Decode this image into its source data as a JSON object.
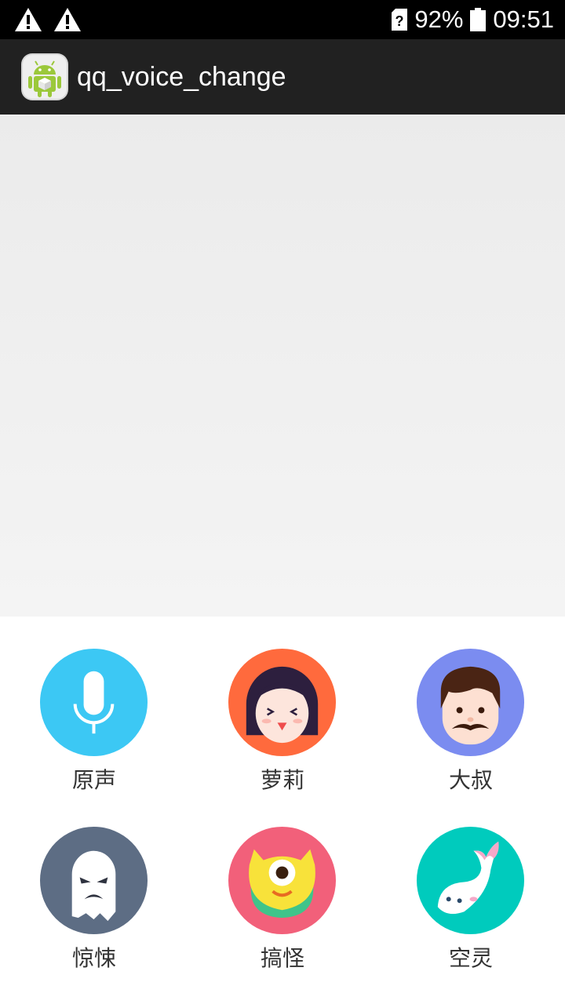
{
  "status_bar": {
    "battery": "92%",
    "time": "09:51",
    "icons": [
      "warning-icon",
      "warning-icon",
      "sim-unknown-icon",
      "battery-icon"
    ]
  },
  "app_bar": {
    "title": "qq_voice_change",
    "icon": "android-app-icon"
  },
  "voice_options": [
    {
      "label": "原声",
      "icon": "microphone-icon",
      "color": "#3cc8f4"
    },
    {
      "label": "萝莉",
      "icon": "girl-face-icon",
      "color": "#ff6a3d"
    },
    {
      "label": "大叔",
      "icon": "uncle-face-icon",
      "color": "#7b8cf0"
    },
    {
      "label": "惊悚",
      "icon": "ghost-icon",
      "color": "#5d6d84"
    },
    {
      "label": "搞怪",
      "icon": "monster-icon",
      "color": "#f2607a"
    },
    {
      "label": "空灵",
      "icon": "ethereal-fish-icon",
      "color": "#00cbbd"
    }
  ]
}
